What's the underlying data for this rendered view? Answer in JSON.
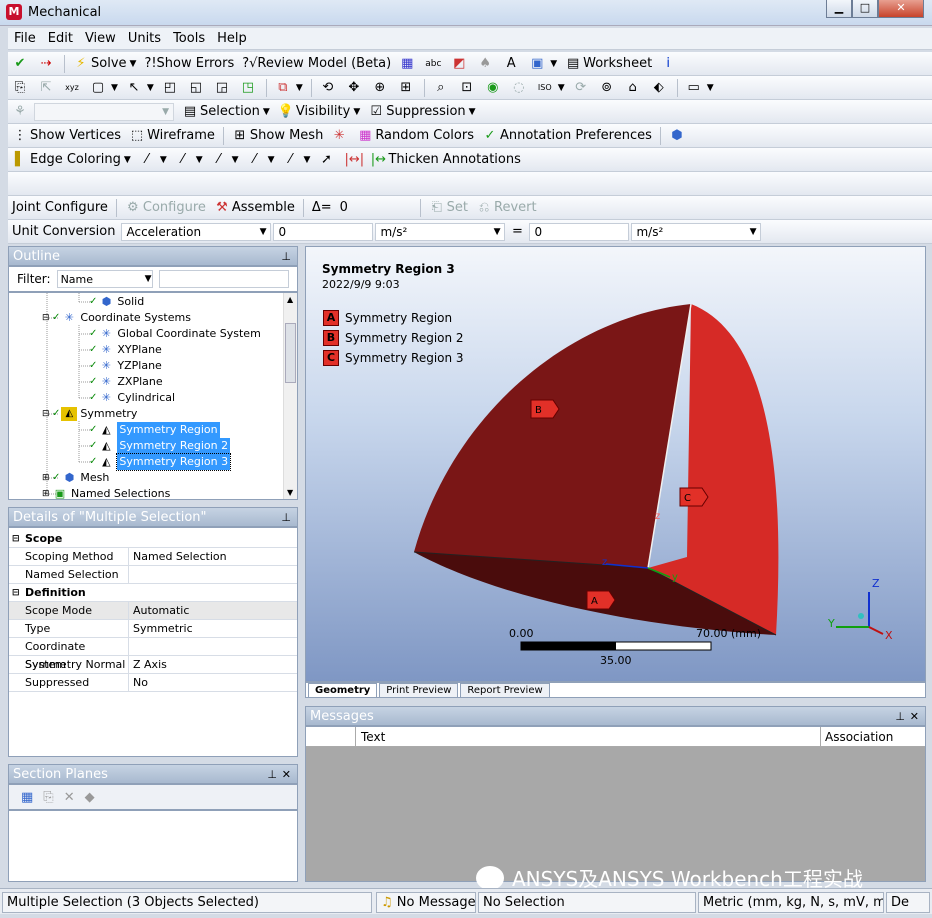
{
  "window": {
    "title": "Mechanical",
    "logo": "M",
    "min": "▁",
    "max": "□",
    "close": "✕"
  },
  "menu": [
    "File",
    "Edit",
    "View",
    "Units",
    "Tools",
    "Help"
  ],
  "toolbar1": {
    "solve": "Solve",
    "show_errors": "?!Show Errors",
    "review_model": "?√Review Model (Beta)",
    "worksheet": "Worksheet"
  },
  "toolbar3": {
    "selection": "Selection",
    "visibility": "Visibility",
    "suppression": "Suppression"
  },
  "toolbar4": {
    "show_vertices": "Show Vertices",
    "wireframe": "Wireframe",
    "show_mesh": "Show Mesh",
    "random_colors": "Random Colors",
    "annotation_prefs": "Annotation Preferences"
  },
  "toolbar5": {
    "edge_coloring": "Edge Coloring",
    "thicken": "Thicken Annotations"
  },
  "joint": {
    "label": "Joint Configure",
    "configure": "Configure",
    "assemble": "Assemble",
    "delta": "Δ=",
    "delta_value": "0",
    "set": "Set",
    "revert": "Revert"
  },
  "unitconv": {
    "label": "Unit Conversion",
    "quantity": "Acceleration",
    "value1": "0",
    "unit1": "m/s²",
    "equals": "=",
    "value2": "0",
    "unit2": "m/s²"
  },
  "outline": {
    "title": "Outline",
    "filter_label": "Filter:",
    "filter_value": "Name",
    "tree": [
      "Solid",
      "Coordinate Systems",
      "Global Coordinate System",
      "XYPlane",
      "YZPlane",
      "ZXPlane",
      "Cylindrical",
      "Symmetry",
      "Symmetry Region",
      "Symmetry Region 2",
      "Symmetry Region 3",
      "Mesh",
      "Named Selections"
    ]
  },
  "details": {
    "title": "Details of \"Multiple Selection\"",
    "sections": [
      {
        "name": "Scope",
        "rows": [
          {
            "k": "Scoping Method",
            "v": "Named Selection"
          },
          {
            "k": "Named Selection",
            "v": ""
          }
        ]
      },
      {
        "name": "Definition",
        "rows": [
          {
            "k": "Scope Mode",
            "v": "Automatic"
          },
          {
            "k": "Type",
            "v": "Symmetric"
          },
          {
            "k": "Coordinate System",
            "v": ""
          },
          {
            "k": "Symmetry Normal",
            "v": "Z Axis"
          },
          {
            "k": "Suppressed",
            "v": "No"
          }
        ]
      }
    ]
  },
  "section_planes": {
    "title": "Section Planes"
  },
  "viewport": {
    "title": "Symmetry Region 3",
    "date": "2022/9/9 9:03",
    "legend": [
      {
        "key": "A",
        "label": "Symmetry Region"
      },
      {
        "key": "B",
        "label": "Symmetry Region 2"
      },
      {
        "key": "C",
        "label": "Symmetry Region 3"
      }
    ],
    "scale_left": "0.00",
    "scale_right": "70.00 (mm)",
    "scale_mid": "35.00",
    "tabs": [
      "Geometry",
      "Print Preview",
      "Report Preview"
    ]
  },
  "messages": {
    "title": "Messages",
    "col_text": "Text",
    "col_assoc": "Association"
  },
  "watermark": "ANSYS及ANSYS Workbench工程实战",
  "status": {
    "selection": "Multiple Selection (3 Objects Selected)",
    "messages": "No Messages",
    "no_selection": "No Selection",
    "units": "Metric (mm, kg, N, s, mV, mA)",
    "deg": "De"
  },
  "colors": {
    "face_b": "#7a1616",
    "face_c": "#d62a26",
    "face_a": "#4a0c0c",
    "accent": "#3399ff"
  }
}
